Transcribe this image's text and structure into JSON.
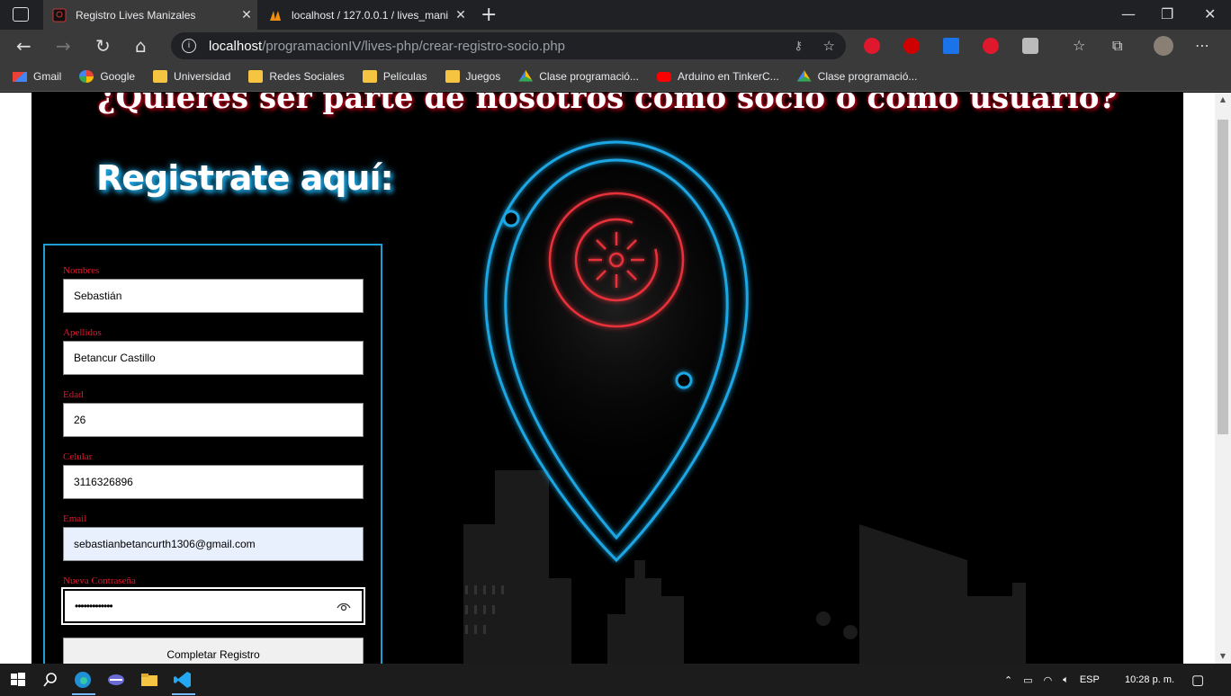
{
  "browser": {
    "tabs": [
      {
        "title": "Registro Lives Manizales",
        "active": true
      },
      {
        "title": "localhost / 127.0.0.1 / lives_mani",
        "active": false
      }
    ],
    "url_host": "localhost",
    "url_path": "/programacionIV/lives-php/crear-registro-socio.php",
    "bookmarks": [
      {
        "label": "Gmail",
        "icon": "gmail-icon"
      },
      {
        "label": "Google",
        "icon": "google-icon"
      },
      {
        "label": "Universidad",
        "icon": "folder-icon"
      },
      {
        "label": "Redes Sociales",
        "icon": "folder-icon"
      },
      {
        "label": "Películas",
        "icon": "folder-icon"
      },
      {
        "label": "Juegos",
        "icon": "folder-icon"
      },
      {
        "label": "Clase programació...",
        "icon": "drive-icon"
      },
      {
        "label": "Arduino en TinkerC...",
        "icon": "youtube-icon"
      },
      {
        "label": "Clase programació...",
        "icon": "drive-icon"
      }
    ]
  },
  "page": {
    "headline": "¿Quieres ser parte de nosotros como socio o como usuario?",
    "subhead": "Registrate aquí:",
    "form": {
      "nombres_label": "Nombres",
      "nombres_value": "Sebastián",
      "apellidos_label": "Apellidos",
      "apellidos_value": "Betancur Castillo",
      "edad_label": "Edad",
      "edad_value": "26",
      "celular_label": "Celular",
      "celular_value": "3116326896",
      "email_label": "Email",
      "email_value": "sebastianbetancurth1306@gmail.com",
      "password_label": "Nueva Contraseña",
      "password_value": "•••••••••••••",
      "submit_label": "Completar Registro"
    }
  },
  "taskbar": {
    "language": "ESP",
    "time": "10:28 p. m."
  },
  "colors": {
    "accent_blue": "#1e9fd4",
    "accent_red": "#e0182d"
  }
}
